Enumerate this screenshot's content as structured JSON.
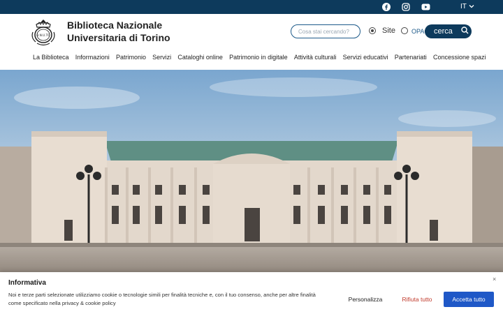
{
  "topbar": {
    "social": [
      "facebook-icon",
      "instagram-icon",
      "youtube-icon"
    ],
    "language": "IT"
  },
  "header": {
    "site_title_line1": "Biblioteca Nazionale",
    "site_title_line2": "Universitaria di Torino",
    "logo_text": "B.N.U.TO",
    "search_placeholder": "Cosa stai cercando?",
    "radio_site": "Site",
    "radio_opac": "OPAC",
    "radio_selected": "Site",
    "search_button": "cerca"
  },
  "nav": {
    "items": [
      "La Biblioteca",
      "Informazioni",
      "Patrimonio",
      "Servizi",
      "Cataloghi online",
      "Patrimonio in digitale",
      "Attività culturali",
      "Servizi educativi",
      "Partenariati",
      "Concessione spazi"
    ]
  },
  "cookie": {
    "title": "Informativa",
    "text": "Noi e terze parti selezionate utilizziamo cookie o tecnologie simili per finalità tecniche e, con il tuo consenso, anche per altre finalità come specificato nella privacy & cookie policy",
    "close": "×",
    "customize": "Personalizza",
    "reject": "Rifiuta tutto",
    "accept": "Accetta tutto"
  },
  "colors": {
    "topbar": "#0d3a5c",
    "accent": "#1f58c7",
    "reject": "#c0392b"
  }
}
